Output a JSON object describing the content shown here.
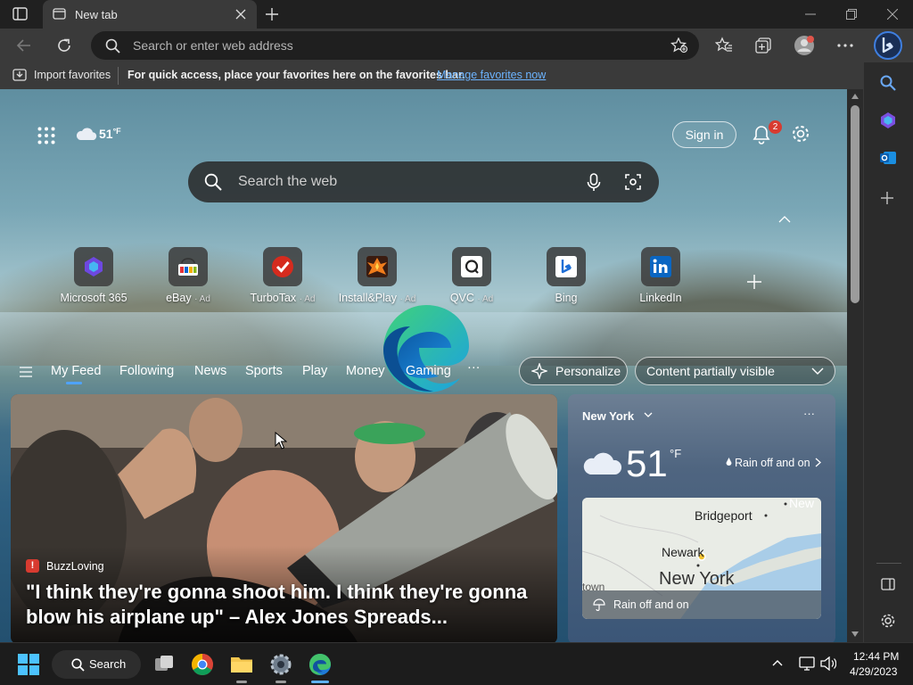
{
  "browser": {
    "tab_title": "New tab",
    "address_placeholder": "Search or enter web address"
  },
  "favorites_bar": {
    "import_label": "Import favorites",
    "hint": "For quick access, place your favorites here on the favorites bar.",
    "manage_link": "Manage favorites now"
  },
  "newtab": {
    "weather_temp": "51",
    "weather_unit": "°F",
    "sign_in": "Sign in",
    "notification_count": "2",
    "search_placeholder": "Search the web",
    "quick_links": [
      {
        "name": "Microsoft 365",
        "ad": ""
      },
      {
        "name": "eBay",
        "ad": "· Ad"
      },
      {
        "name": "TurboTax",
        "ad": "· Ad"
      },
      {
        "name": "Install&Play",
        "ad": "· Ad"
      },
      {
        "name": "QVC",
        "ad": "· Ad"
      },
      {
        "name": "Bing",
        "ad": ""
      },
      {
        "name": "LinkedIn",
        "ad": ""
      }
    ],
    "feed_tabs": [
      "My Feed",
      "Following",
      "News",
      "Sports",
      "Play",
      "Money",
      "Gaming"
    ],
    "more": "···",
    "personalize": "Personalize",
    "content_visibility": "Content partially visible"
  },
  "news_card": {
    "source": "BuzzLoving",
    "headline": "\"I think they're gonna shoot him. I think they're gonna blow his airplane up\" – Alex Jones Spreads..."
  },
  "weather_card": {
    "location": "New York",
    "more": "···",
    "temp": "51",
    "unit": "°F",
    "condition": "Rain off and on",
    "map_labels": {
      "bridgeport": "Bridgeport",
      "newark": "Newark",
      "new_york": "New York",
      "new": "New",
      "town": "town"
    },
    "map_caption": "Rain off and on"
  },
  "taskbar": {
    "search_label": "Search",
    "time": "12:44 PM",
    "date": "4/29/2023"
  },
  "colors": {
    "accent_link": "#6cb4ff",
    "edge_blue": "#1f7ad6",
    "edge_green": "#43c26a",
    "notification_red": "#d83b30"
  }
}
